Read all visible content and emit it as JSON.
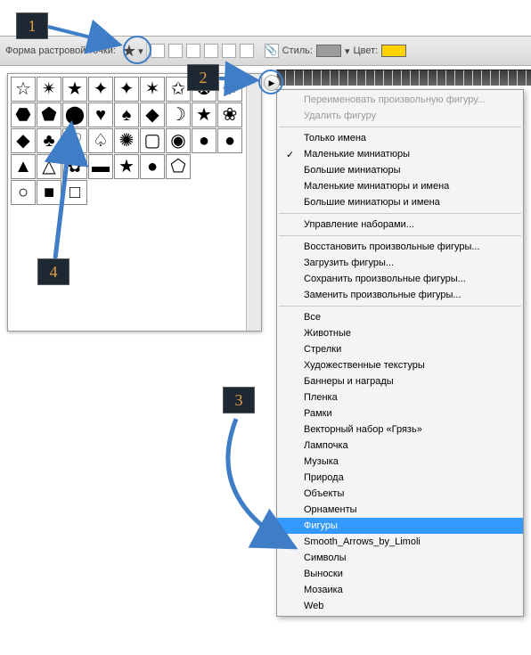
{
  "toolbar": {
    "shape_label": "Форма растровой точки:",
    "style_label": "Стиль:",
    "color_label": "Цвет:",
    "style_swatch": "#9c9c9c",
    "color_swatch": "#ffd200"
  },
  "badges": {
    "b1": "1",
    "b2": "2",
    "b3": "3",
    "b4": "4"
  },
  "shapes_panel": {
    "icons": [
      "star5o",
      "burst-o",
      "star5",
      "star-thin",
      "star4",
      "star6",
      "star-frame",
      "star-ring",
      "sun",
      "hex",
      "pent",
      "blob",
      "heart",
      "spade",
      "diamond-r",
      "crescent",
      "star5-lg",
      "blob2",
      "diam",
      "club",
      "heart-o",
      "spade2",
      "starburst",
      "sq-round",
      "shield",
      "dot",
      "dot",
      "tri-up",
      "tri-up-o",
      "splat",
      "rect-r",
      "star5-s",
      "circ",
      "pent-s",
      "",
      "",
      "circ-o",
      "square",
      "square-o",
      "",
      "",
      "",
      "",
      "",
      ""
    ]
  },
  "menu": {
    "rename": "Переименовать произвольную фигуру...",
    "delete": "Удалить фигуру",
    "names_only": "Только имена",
    "small_thumb": "Маленькие миниатюры",
    "large_thumb": "Большие миниатюры",
    "small_thumb_names": "Маленькие миниатюры и имена",
    "large_thumb_names": "Большие миниатюры и имена",
    "manage_sets": "Управление наборами...",
    "restore": "Восстановить произвольные фигуры...",
    "load": "Загрузить фигуры...",
    "save": "Сохранить произвольные фигуры...",
    "replace": "Заменить произвольные фигуры...",
    "all": "Все",
    "animals": "Животные",
    "arrows": "Стрелки",
    "textures": "Художественные текстуры",
    "banners": "Баннеры и награды",
    "film": "Пленка",
    "frames": "Рамки",
    "vector_mud": "Векторный набор «Грязь»",
    "lamp": "Лампочка",
    "music": "Музыка",
    "nature": "Природа",
    "objects": "Объекты",
    "ornaments": "Орнаменты",
    "figures": "Фигуры",
    "smooth": "Smooth_Arrows_by_Limoli",
    "symbols": "Символы",
    "callouts": "Выноски",
    "mosaic": "Мозаика",
    "web": "Web"
  }
}
